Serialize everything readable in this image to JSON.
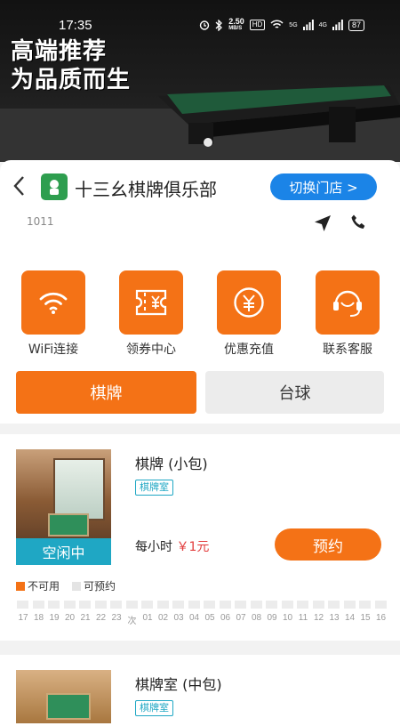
{
  "status_bar": {
    "time": "17:35",
    "net_speed": "2.50",
    "net_unit": "MB/S",
    "hd": "HD",
    "signal1": "5G",
    "signal2": "4G",
    "battery": "87"
  },
  "banner": {
    "line1": "高端推荐",
    "line2": "为品质而生"
  },
  "store": {
    "name": "十三幺棋牌俱乐部",
    "switch_label": "切换门店 >",
    "code": "1011"
  },
  "quick_actions": [
    {
      "label": "WiFi连接",
      "icon": "wifi-icon"
    },
    {
      "label": "领券中心",
      "icon": "ticket-icon"
    },
    {
      "label": "优惠充值",
      "icon": "yuan-icon"
    },
    {
      "label": "联系客服",
      "icon": "headset-icon"
    }
  ],
  "tabs": [
    {
      "label": "棋牌",
      "active": true
    },
    {
      "label": "台球",
      "active": false
    }
  ],
  "rooms": [
    {
      "name": "棋牌 (小包)",
      "tag": "棋牌室",
      "status": "空闲中",
      "price_prefix": "每小时",
      "price": "￥1元",
      "book_label": "预约",
      "legend_busy": "不可用",
      "legend_free": "可预约",
      "slots": [
        "17",
        "18",
        "19",
        "20",
        "21",
        "22",
        "23",
        "次",
        "01",
        "02",
        "03",
        "04",
        "05",
        "06",
        "07",
        "08",
        "09",
        "10",
        "11",
        "12",
        "13",
        "14",
        "15",
        "16"
      ]
    },
    {
      "name": "棋牌室 (中包)",
      "tag": "棋牌室"
    }
  ],
  "colors": {
    "accent": "#f47216",
    "blue": "#1b84e7",
    "teal": "#1fa7c4"
  }
}
